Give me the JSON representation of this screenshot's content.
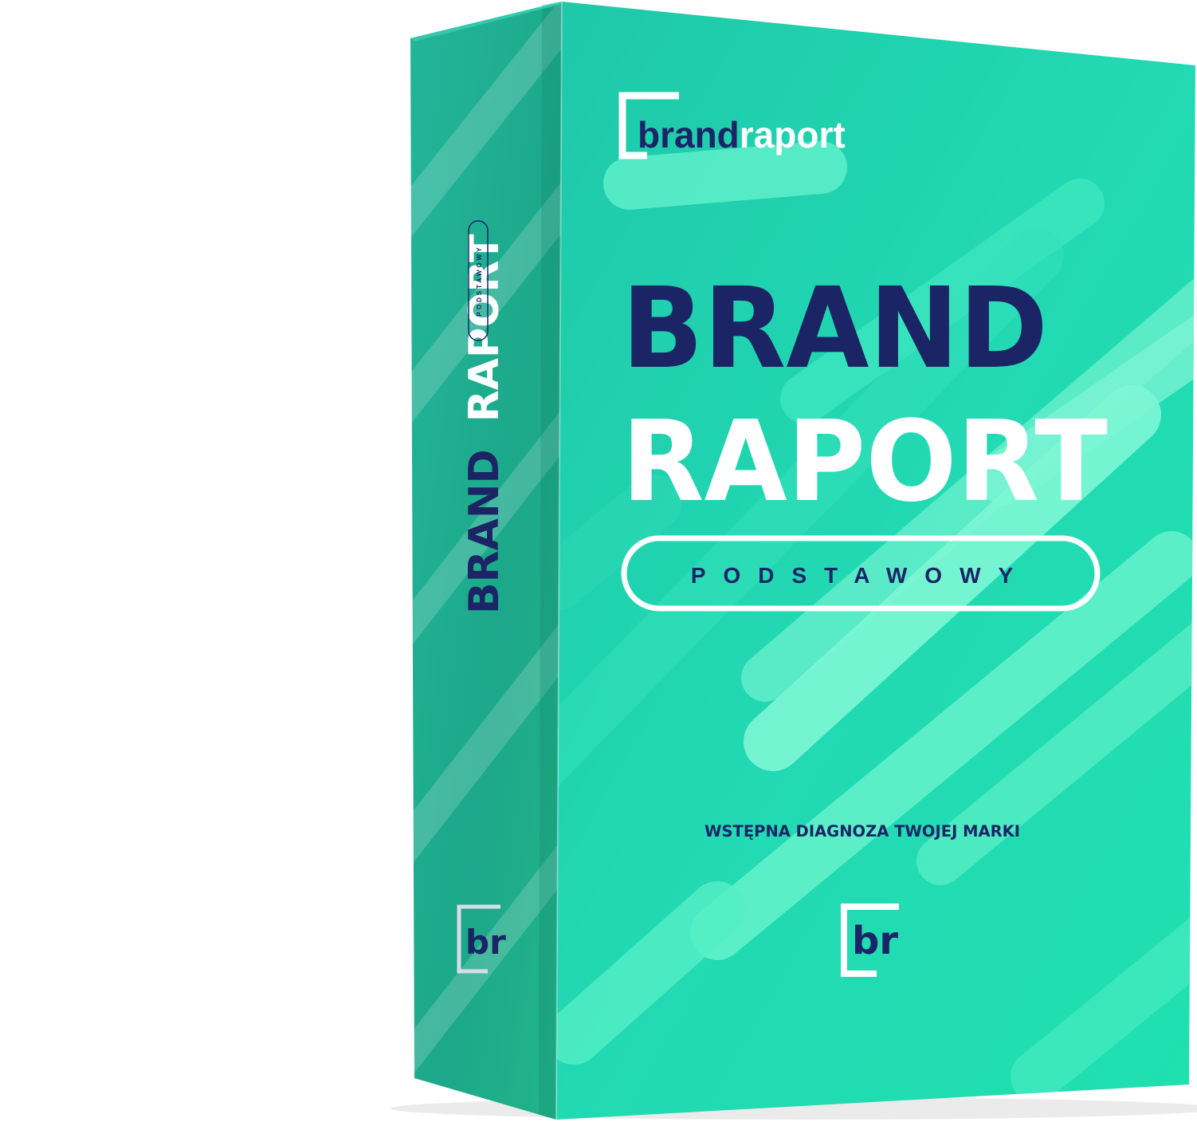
{
  "box": {
    "logo": {
      "part1": "brand",
      "part2": "raport"
    },
    "title": {
      "line1": "BRAND",
      "line2": "RAPORT"
    },
    "badge": "PODSTAWOWY",
    "tagline": "WSTĘPNA DIAGNOZA TWOJEJ MARKI",
    "bottom_mark": "br",
    "spine": {
      "title_part1": "BRAND",
      "title_part2": "RAPORT",
      "badge": "PODSTAWOWY",
      "mark": "br"
    }
  },
  "icons": [
    "bracket-logo-mark-icon",
    "br-monogram-icon"
  ],
  "colors": {
    "navy": "#1b2566",
    "white": "#ffffff",
    "front_mint": "#25dcb6",
    "spine_green": "#1ba68c"
  }
}
